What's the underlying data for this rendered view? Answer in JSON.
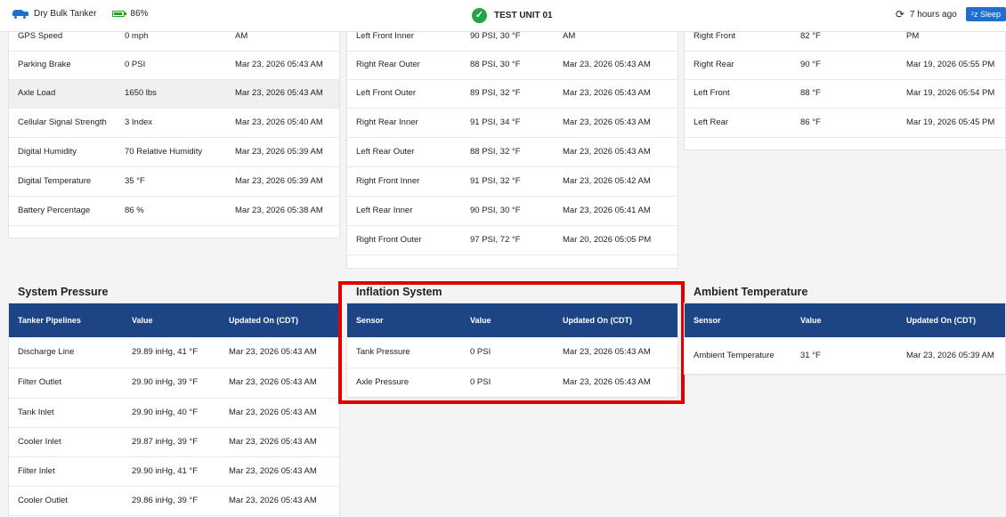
{
  "header": {
    "vehicle": "Dry Bulk Tanker",
    "battery": "86%",
    "battery_level": 0.86,
    "unit_name": "TEST UNIT 01",
    "last_seen": "7 hours ago",
    "sleep_label": "Sleep"
  },
  "sensors_table": {
    "partial_row": {
      "name": "GPS Speed",
      "value": "0 mph",
      "date": "AM"
    },
    "rows": [
      {
        "name": "Parking Brake",
        "value": "0 PSI",
        "date": "Mar 23, 2026 05:43 AM"
      },
      {
        "name": "Axle Load",
        "value": "1650 lbs",
        "date": "Mar 23, 2026 05:43 AM"
      },
      {
        "name": "Cellular Signal Strength",
        "value": "3 Index",
        "date": "Mar 23, 2026 05:40 AM"
      },
      {
        "name": "Digital Humidity",
        "value": "70 Relative Humidity",
        "date": "Mar 23, 2026 05:39 AM"
      },
      {
        "name": "Digital Temperature",
        "value": "35 °F",
        "date": "Mar 23, 2026 05:39 AM"
      },
      {
        "name": "Battery Percentage",
        "value": "86 %",
        "date": "Mar 23, 2026 05:38 AM"
      }
    ]
  },
  "tire_table": {
    "partial_row": {
      "name": "Left Front Inner",
      "value": "90 PSI, 30 °F",
      "date": "AM"
    },
    "rows": [
      {
        "name": "Right Rear Outer",
        "value": "88 PSI, 30 °F",
        "date": "Mar 23, 2026 05:43 AM"
      },
      {
        "name": "Left Front Outer",
        "value": "89 PSI, 32 °F",
        "date": "Mar 23, 2026 05:43 AM"
      },
      {
        "name": "Right Rear Inner",
        "value": "91 PSI, 34 °F",
        "date": "Mar 23, 2026 05:43 AM"
      },
      {
        "name": "Left Rear Outer",
        "value": "88 PSI, 32 °F",
        "date": "Mar 23, 2026 05:43 AM"
      },
      {
        "name": "Right Front Inner",
        "value": "91 PSI, 32 °F",
        "date": "Mar 23, 2026 05:42 AM"
      },
      {
        "name": "Left Rear Inner",
        "value": "90 PSI, 30 °F",
        "date": "Mar 23, 2026 05:41 AM"
      },
      {
        "name": "Right Front Outer",
        "value": "97 PSI, 72 °F",
        "date": "Mar 20, 2026 05:05 PM"
      }
    ]
  },
  "hub_table": {
    "partial_row": {
      "name": "Right Front",
      "value": "82 °F",
      "date": "PM"
    },
    "rows": [
      {
        "name": "Right Rear",
        "value": "90 °F",
        "date": "Mar 19, 2026 05:55 PM"
      },
      {
        "name": "Left Front",
        "value": "88 °F",
        "date": "Mar 19, 2026 05:54 PM"
      },
      {
        "name": "Left Rear",
        "value": "86 °F",
        "date": "Mar 19, 2026 05:45 PM"
      }
    ]
  },
  "system_pressure": {
    "title": "System Pressure",
    "headers": [
      "Tanker Pipelines",
      "Value",
      "Updated On (CDT)"
    ],
    "rows": [
      {
        "name": "Discharge Line",
        "value": "29.89 inHg, 41 °F",
        "date": "Mar 23, 2026 05:43 AM"
      },
      {
        "name": "Filter Outlet",
        "value": "29.90 inHg, 39 °F",
        "date": "Mar 23, 2026 05:43 AM"
      },
      {
        "name": "Tank Inlet",
        "value": "29.90 inHg, 40 °F",
        "date": "Mar 23, 2026 05:43 AM"
      },
      {
        "name": "Cooler Inlet",
        "value": "29.87 inHg, 39 °F",
        "date": "Mar 23, 2026 05:43 AM"
      },
      {
        "name": "Filter Inlet",
        "value": "29.90 inHg, 41 °F",
        "date": "Mar 23, 2026 05:43 AM"
      },
      {
        "name": "Cooler Outlet",
        "value": "29.86 inHg, 39 °F",
        "date": "Mar 23, 2026 05:43 AM"
      }
    ]
  },
  "inflation_system": {
    "title": "Inflation System",
    "headers": [
      "Sensor",
      "Value",
      "Updated On (CDT)"
    ],
    "rows": [
      {
        "name": "Tank Pressure",
        "value": "0 PSI",
        "date": "Mar 23, 2026 05:43 AM"
      },
      {
        "name": "Axle Pressure",
        "value": "0 PSI",
        "date": "Mar 23, 2026 05:43 AM"
      }
    ]
  },
  "ambient_temperature": {
    "title": "Ambient Temperature",
    "headers": [
      "Sensor",
      "Value",
      "Updated On (CDT)"
    ],
    "rows": [
      {
        "name": "Ambient Temperature",
        "value": "31 °F",
        "date": "Mar 23, 2026 05:39 AM"
      }
    ]
  },
  "colors": {
    "header_blue": "#1d4585",
    "accent_blue": "#1f6fd1",
    "ok_green": "#22a447",
    "highlight_red": "#e00000"
  }
}
